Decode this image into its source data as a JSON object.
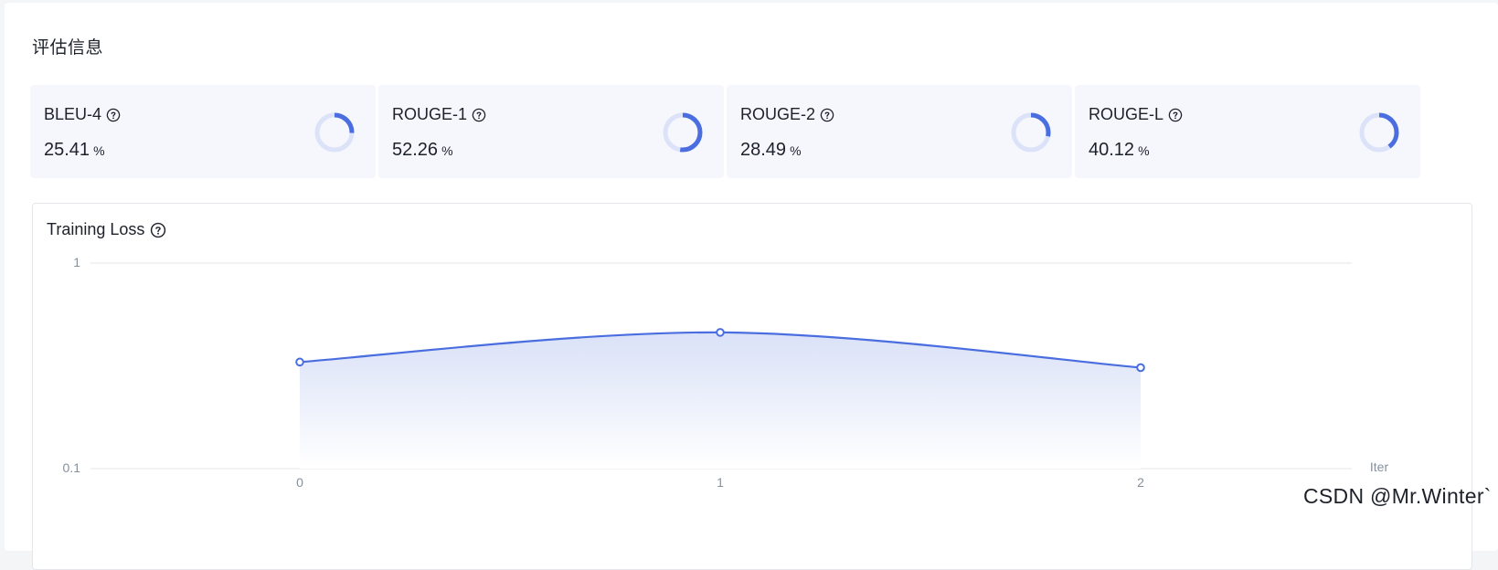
{
  "section": {
    "title": "评估信息"
  },
  "metrics": [
    {
      "name": "BLEU-4",
      "value": "25.41",
      "unit": "%",
      "fraction": 0.2541
    },
    {
      "name": "ROUGE-1",
      "value": "52.26",
      "unit": "%",
      "fraction": 0.5226
    },
    {
      "name": "ROUGE-2",
      "value": "28.49",
      "unit": "%",
      "fraction": 0.2849
    },
    {
      "name": "ROUGE-L",
      "value": "40.12",
      "unit": "%",
      "fraction": 0.4012
    }
  ],
  "icons": {
    "help": "question-circle-icon"
  },
  "colors": {
    "accent": "#4a6ee0",
    "ring_track": "#dce3f8",
    "card_bg": "#f5f7fd",
    "area_top": "#d8e0f7"
  },
  "loss_chart": {
    "title": "Training Loss",
    "chart_data": {
      "type": "line",
      "x": [
        0,
        1,
        2
      ],
      "y": [
        0.33,
        0.46,
        0.31
      ],
      "xlabel": "Iter",
      "ylabel": "",
      "yscale": "log",
      "ylim": [
        0.1,
        1
      ],
      "x_tick_labels": [
        "0",
        "1",
        "2"
      ],
      "y_tick_labels": [
        "0.1",
        "1"
      ],
      "area_fill": true,
      "grid": true
    }
  },
  "watermark": "CSDN @Mr.Winter`"
}
